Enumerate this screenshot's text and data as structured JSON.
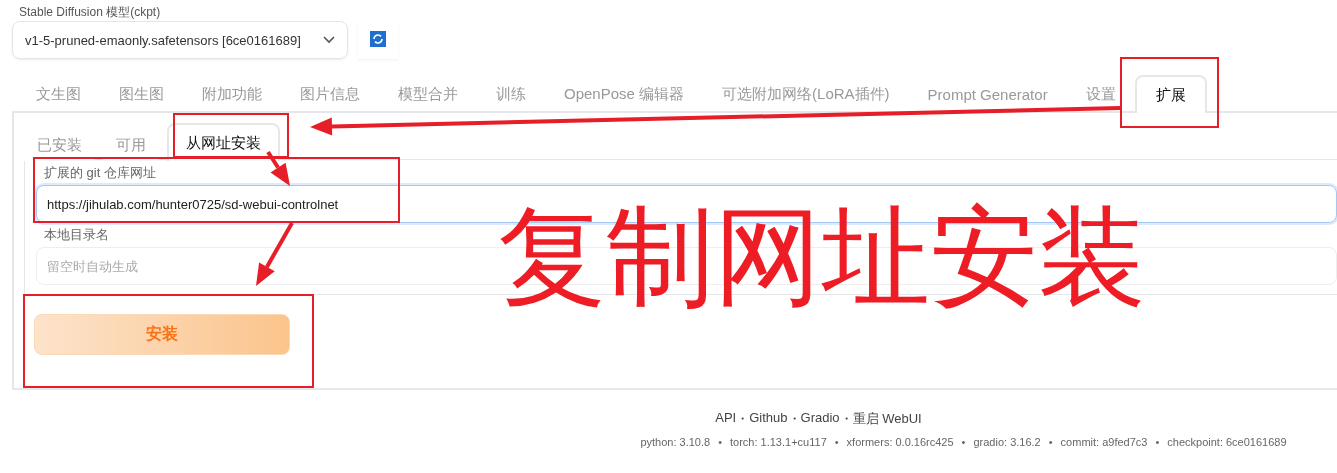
{
  "model": {
    "label": "Stable Diffusion 模型(ckpt)",
    "value": "v1-5-pruned-emaonly.safetensors [6ce0161689]"
  },
  "tabs": [
    {
      "label": "文生图",
      "selected": false
    },
    {
      "label": "图生图",
      "selected": false
    },
    {
      "label": "附加功能",
      "selected": false
    },
    {
      "label": "图片信息",
      "selected": false
    },
    {
      "label": "模型合并",
      "selected": false
    },
    {
      "label": "训练",
      "selected": false
    },
    {
      "label": "OpenPose 编辑器",
      "selected": false
    },
    {
      "label": "可选附加网络(LoRA插件)",
      "selected": false
    },
    {
      "label": "Prompt Generator",
      "selected": false
    },
    {
      "label": "设置",
      "selected": false
    },
    {
      "label": "扩展",
      "selected": true
    }
  ],
  "subtabs": [
    {
      "label": "已安装",
      "selected": false
    },
    {
      "label": "可用",
      "selected": false
    },
    {
      "label": "从网址安装",
      "selected": true
    }
  ],
  "fields": [
    {
      "label": "扩展的 git 仓库网址",
      "value": "https://jihulab.com/hunter0725/sd-webui-controlnet",
      "focused": true
    },
    {
      "label": "本地目录名",
      "placeholder": "留空时自动生成",
      "focused": false
    }
  ],
  "install_button": "安装",
  "footer": {
    "separator": "・",
    "links": [
      "API",
      "Github",
      "Gradio",
      "重启 WebUI"
    ]
  },
  "versions": {
    "separator": "•",
    "items": [
      "python: 3.10.8",
      "torch: 1.13.1+cu117",
      "xformers: 0.0.16rc425",
      "gradio: 3.16.2",
      "commit: a9fed7c3",
      "checkpoint: 6ce0161689"
    ]
  },
  "annotation": {
    "note": "复制网址安装"
  }
}
